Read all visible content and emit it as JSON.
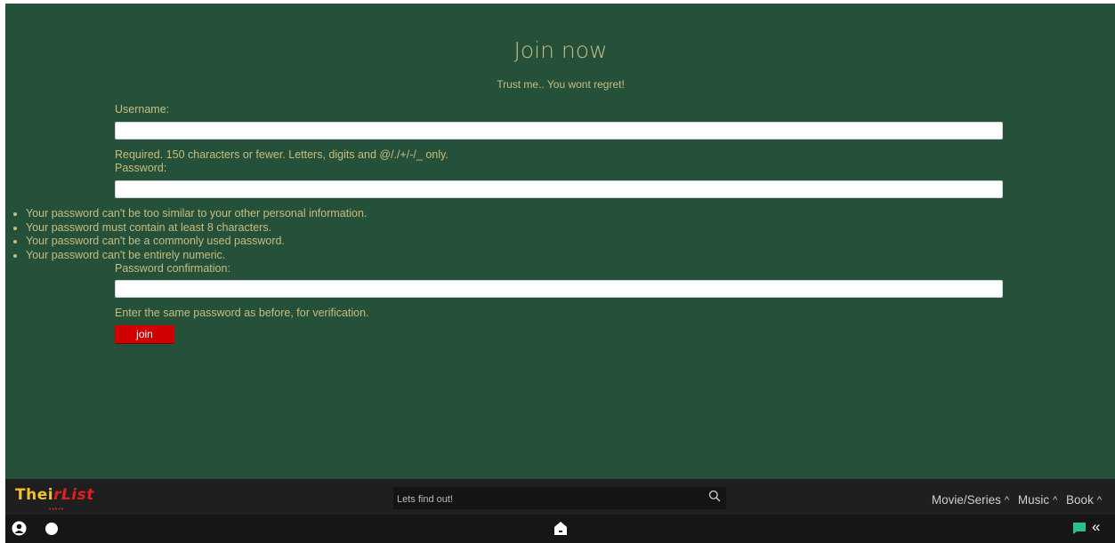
{
  "signup": {
    "title": "Join now",
    "subtitle": "Trust me.. You wont regret!",
    "username_label": "Username:",
    "username_value": "",
    "username_help": "Required. 150 characters or fewer. Letters, digits and @/./+/-/_ only.",
    "password_label": "Password:",
    "password_value": "",
    "password_rules": [
      "Your password can't be too similar to your other personal information.",
      "Your password must contain at least 8 characters.",
      "Your password can't be a commonly used password.",
      "Your password can't be entirely numeric."
    ],
    "confirm_label": "Password confirmation:",
    "confirm_value": "",
    "confirm_help": "Enter the same password as before, for verification.",
    "join_label": "join"
  },
  "footer": {
    "logo_text_a": "Thei",
    "logo_text_b": "rList",
    "search_placeholder": "Lets find out!",
    "categories": [
      "Movie/Series",
      "Music",
      "Book"
    ],
    "icons": {
      "search": "search-icon",
      "user": "user-icon",
      "theme": "theme-toggle",
      "home": "home-icon",
      "chat": "chat-icon",
      "collapse": "collapse-icon",
      "caret": "chevron-up-icon"
    }
  },
  "colors": {
    "main_bg": "#25503a",
    "text": "#c9bd7e",
    "button": "#d10000",
    "footer": "#1f1f1f",
    "chat": "#2bbf8f"
  }
}
